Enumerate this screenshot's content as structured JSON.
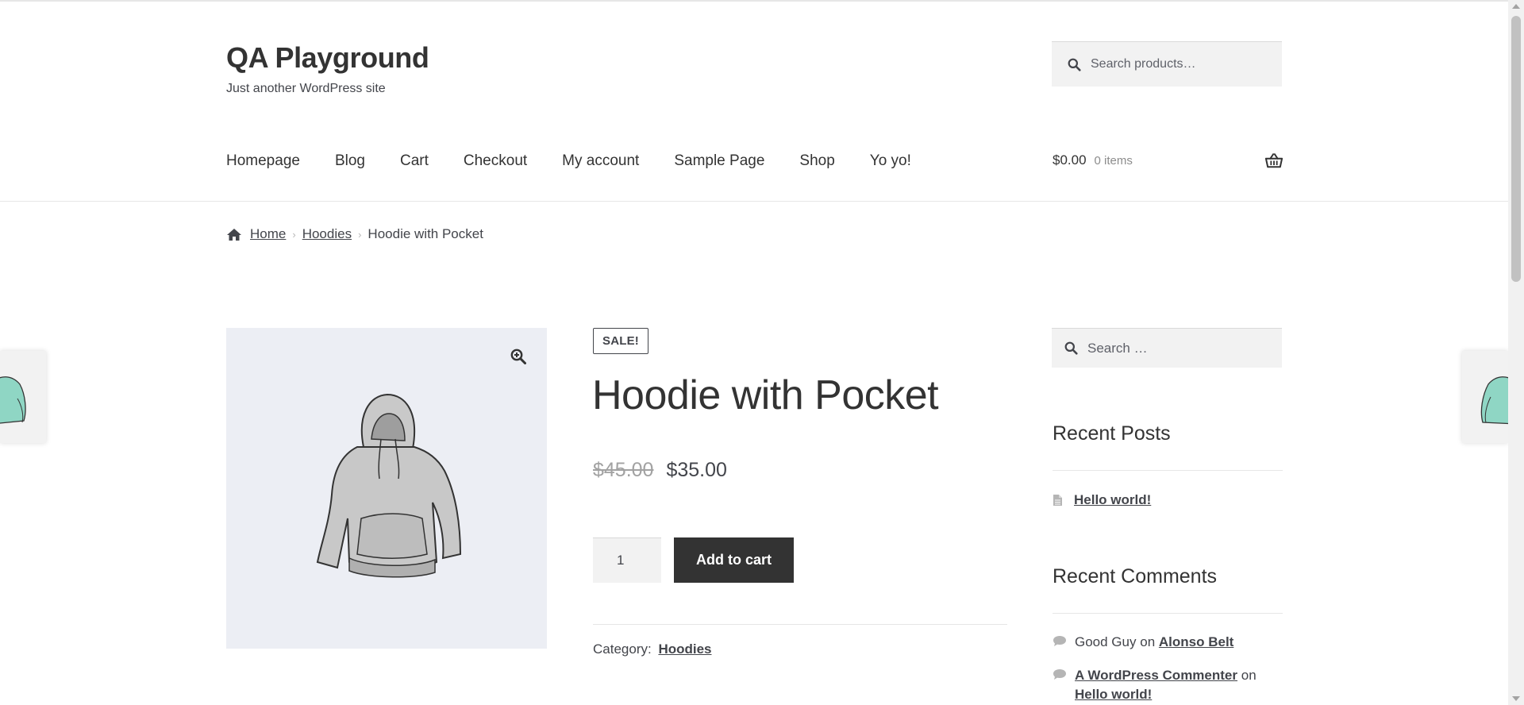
{
  "site": {
    "title": "QA Playground",
    "tagline": "Just another WordPress site"
  },
  "header_search": {
    "placeholder": "Search products…"
  },
  "nav": {
    "items": [
      {
        "label": "Homepage"
      },
      {
        "label": "Blog"
      },
      {
        "label": "Cart"
      },
      {
        "label": "Checkout"
      },
      {
        "label": "My account"
      },
      {
        "label": "Sample Page"
      },
      {
        "label": "Shop"
      },
      {
        "label": "Yo yo!"
      }
    ]
  },
  "mini_cart": {
    "amount": "$0.00",
    "count": "0 items",
    "icon": "basket-icon"
  },
  "breadcrumb": {
    "home": "Home",
    "category": "Hoodies",
    "current": "Hoodie with Pocket"
  },
  "product": {
    "badge": "SALE!",
    "title": "Hoodie with Pocket",
    "regular_price": "$45.00",
    "sale_price": "$35.00",
    "quantity": "1",
    "add_to_cart_label": "Add to cart",
    "category_label": "Category:",
    "category": "Hoodies"
  },
  "sidebar": {
    "search_placeholder": "Search …",
    "recent_posts_title": "Recent Posts",
    "recent_posts": [
      {
        "title": "Hello world!"
      }
    ],
    "recent_comments_title": "Recent Comments",
    "recent_comments": [
      {
        "author": "Good Guy",
        "on": "on",
        "post": "Alonso Belt"
      },
      {
        "author": "A WordPress Commenter",
        "on": "on",
        "post": "Hello world!"
      }
    ]
  },
  "colors": {
    "text": "#43454b",
    "heading": "#333333",
    "button_bg": "#333333",
    "input_bg": "#f2f2f2",
    "image_bg": "#eceef4",
    "strike_price": "#a2a2a2"
  }
}
